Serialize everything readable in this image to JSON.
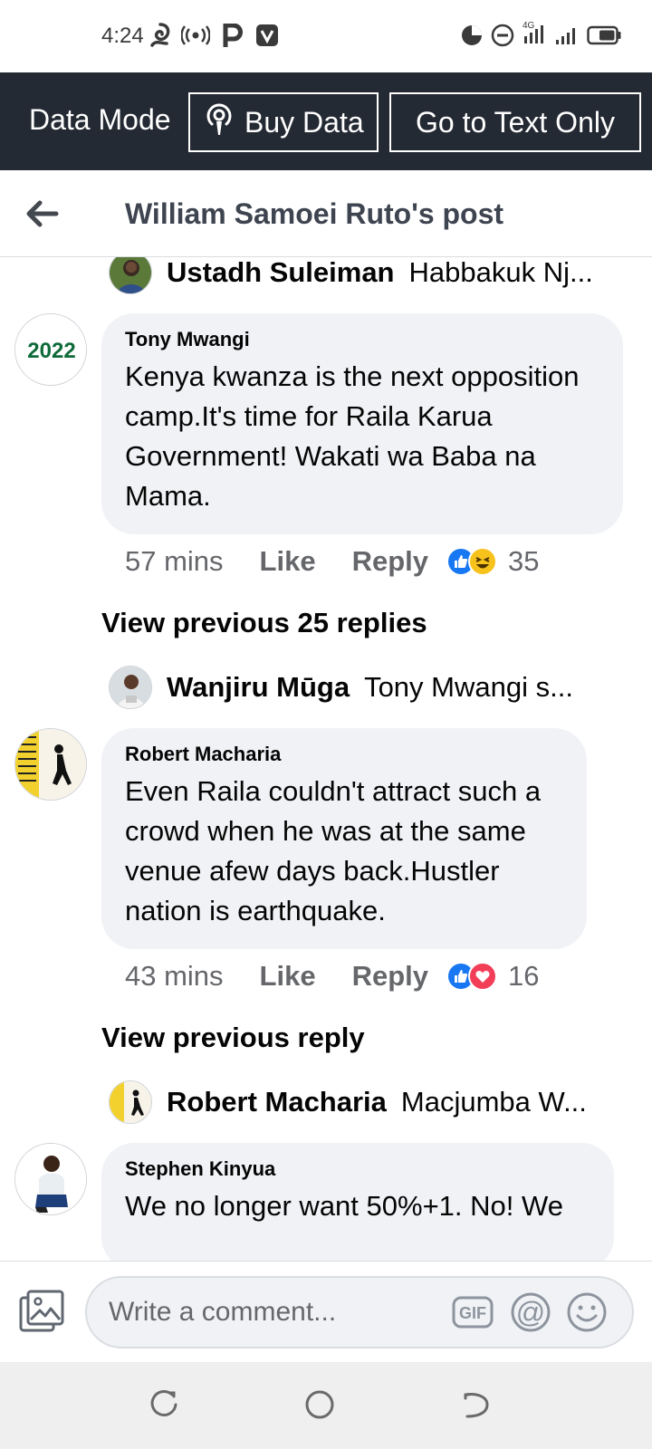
{
  "status_bar": {
    "time": "4:24",
    "network_badge": "4G"
  },
  "data_bar": {
    "mode_label": "Data Mode",
    "buy_data_label": "Buy Data",
    "text_only_label": "Go to Text Only"
  },
  "header": {
    "title": "William Samoei Ruto's post"
  },
  "feed": {
    "reply_1": {
      "author": "Ustadh Suleiman",
      "preview": "Habbakuk Nj..."
    },
    "comment_1": {
      "avatar_text": "2022",
      "author": "Tony Mwangi",
      "text": "Kenya kwanza is the next opposition camp.It's time for Raila Karua Government! Wakati wa Baba na Mama.",
      "time": "57 mins",
      "like_label": "Like",
      "reply_label": "Reply",
      "reaction_count": "35"
    },
    "view_previous_1": "View previous 25 replies",
    "reply_2": {
      "author": "Wanjiru Mūga",
      "preview": "Tony Mwangi s..."
    },
    "comment_2": {
      "author": "Robert Macharia",
      "text": "Even Raila couldn't attract such a crowd when he was at the same venue afew days back.Hustler nation is earthquake.",
      "time": "43 mins",
      "like_label": "Like",
      "reply_label": "Reply",
      "reaction_count": "16"
    },
    "view_previous_2": "View previous reply",
    "reply_3": {
      "author": "Robert Macharia",
      "preview": "Macjumba W..."
    },
    "comment_3": {
      "author": "Stephen Kinyua",
      "text": "We no longer want 50%+1. No! We"
    }
  },
  "composer": {
    "placeholder": "Write a comment...",
    "gif_label": "GIF",
    "mention_label": "@"
  },
  "colors": {
    "data_bar_bg": "#242a33",
    "bubble_bg": "#f0f2f5",
    "like_blue": "#1877f2",
    "love_red": "#f33e58",
    "haha_yellow": "#f7c21b",
    "avatar_2022_green": "#0f6b3a"
  }
}
